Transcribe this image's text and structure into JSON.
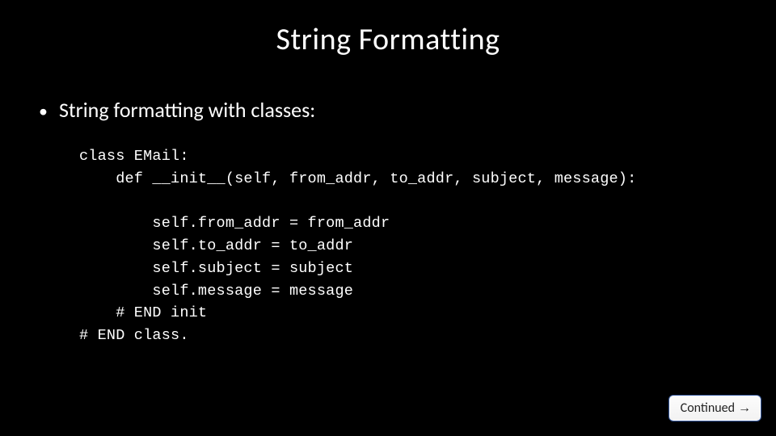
{
  "title": "String Formatting",
  "bullet": {
    "marker": "•",
    "text": "String formatting with classes:"
  },
  "code": "class EMail:\n    def __init__(self, from_addr, to_addr, subject, message):\n\n        self.from_addr = from_addr\n        self.to_addr = to_addr\n        self.subject = subject\n        self.message = message\n    # END init\n# END class.",
  "footer": {
    "continued_label": "Continued",
    "arrow": "→"
  }
}
